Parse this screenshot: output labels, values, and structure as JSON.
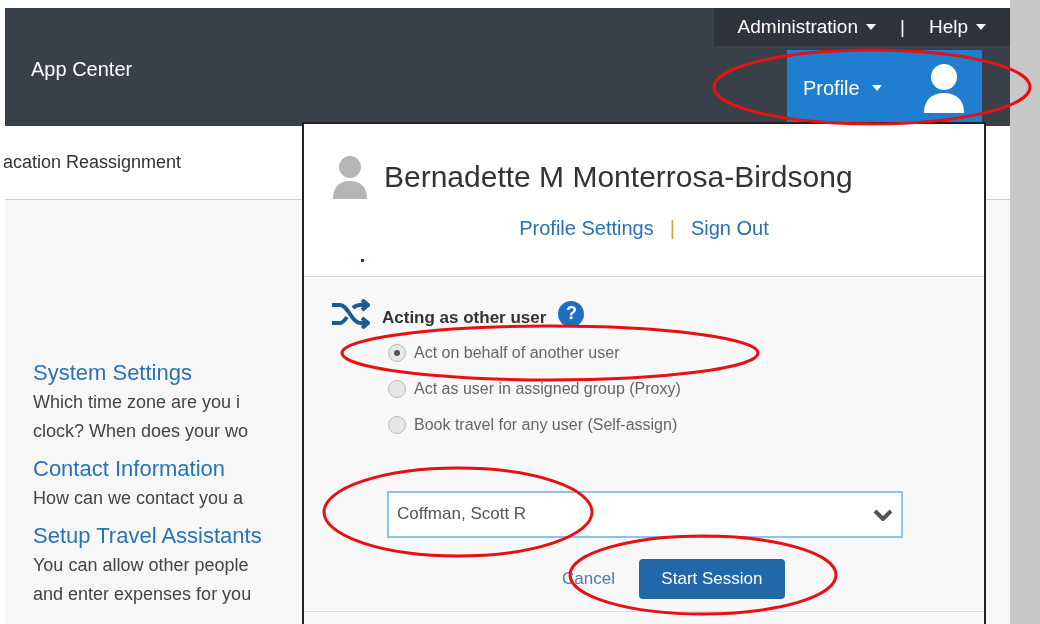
{
  "top_nav": {
    "links": [
      {
        "label": "Administration"
      },
      {
        "label": "Help"
      }
    ],
    "separator": "|"
  },
  "app_title": "App Center",
  "profile_button": {
    "label": "Profile",
    "expanded": true
  },
  "subnav": {
    "item": "acation Reassignment"
  },
  "sections": [
    {
      "title": "System Settings",
      "lines": [
        "Which time zone are you i",
        "clock? When does your wo"
      ]
    },
    {
      "title": "Contact Information",
      "lines": [
        "How can we contact you a"
      ]
    },
    {
      "title": "Setup Travel Assistants",
      "lines": [
        "You can allow other people",
        "and enter expenses for you"
      ]
    }
  ],
  "profile_menu": {
    "user_name": "Bernadette M Monterrosa-Birdsong",
    "links": [
      {
        "label": "Profile Settings"
      },
      {
        "label": "Sign Out"
      }
    ],
    "separator": "|",
    "acting": {
      "title": "Acting as other user",
      "help": "?",
      "options": [
        {
          "label": "Act on behalf of another user",
          "selected": true
        },
        {
          "label": "Act as user in assigned group (Proxy)",
          "selected": false
        },
        {
          "label": "Book travel for any user (Self-assign)",
          "selected": false
        }
      ],
      "user_field": {
        "value": "Coffman, Scott R"
      },
      "cancel": "Cancel",
      "start": "Start Session"
    }
  },
  "annotations": [
    {
      "kind": "ellipse"
    },
    {
      "kind": "ellipse"
    },
    {
      "kind": "ellipse"
    },
    {
      "kind": "ellipse"
    }
  ]
}
